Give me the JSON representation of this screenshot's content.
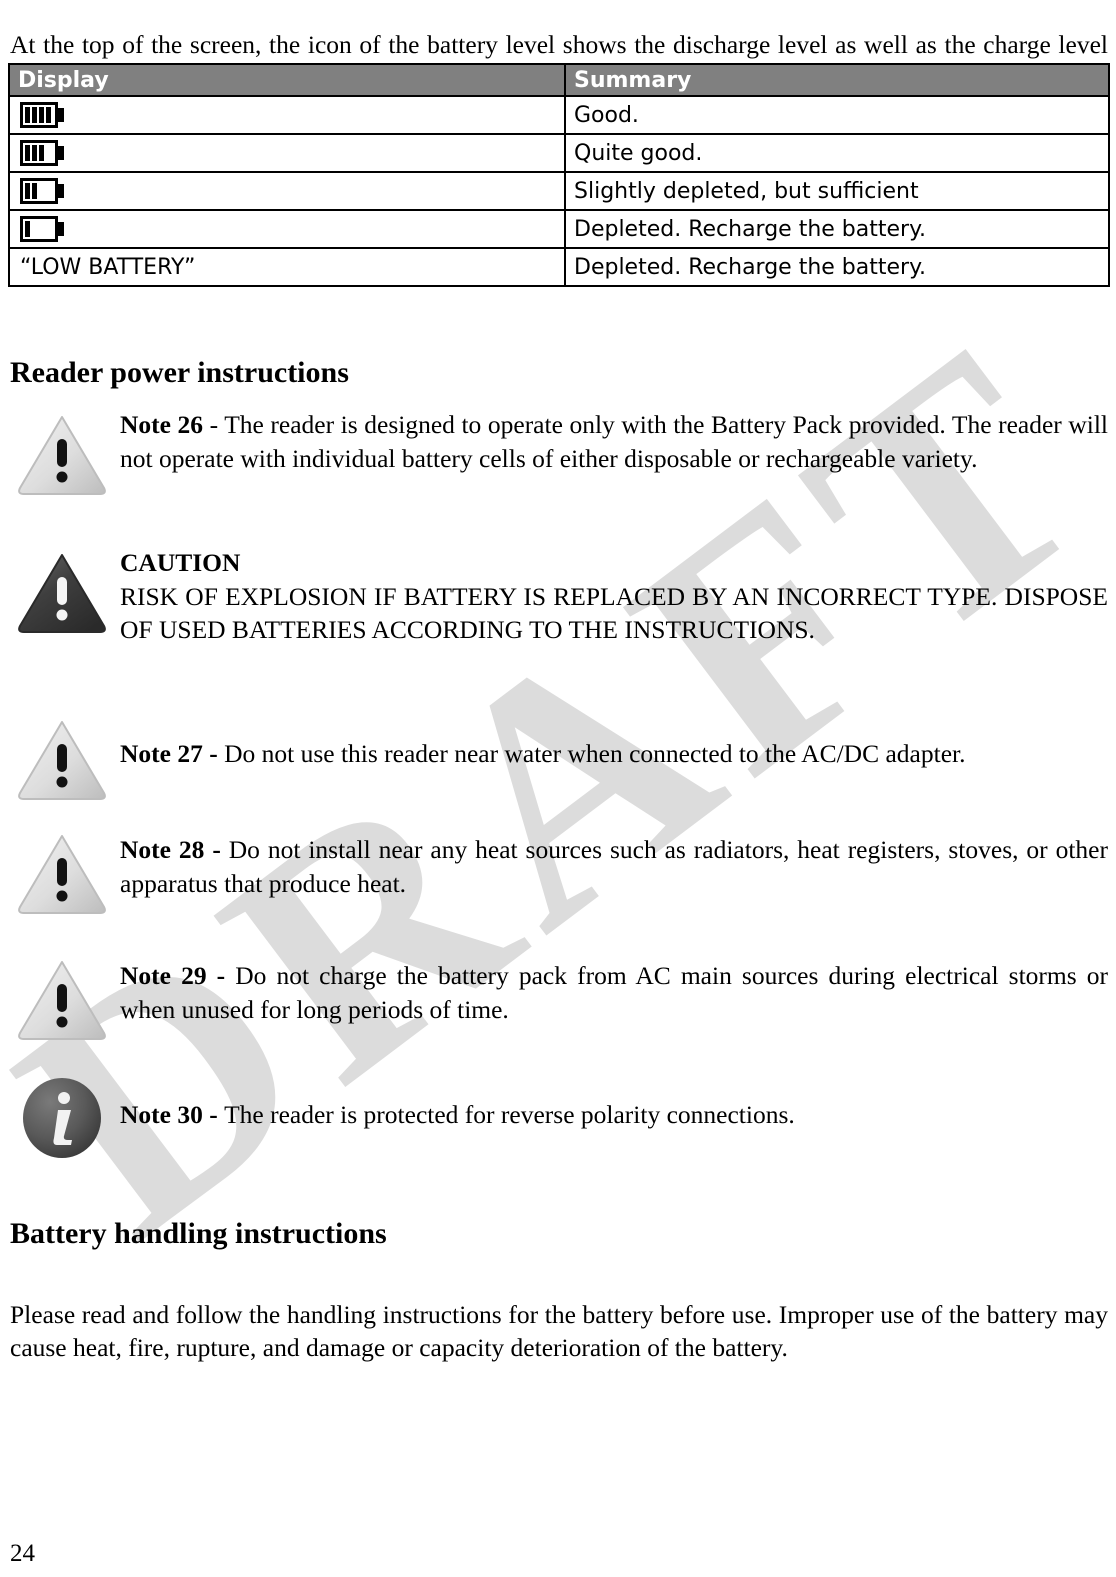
{
  "page": {
    "number": "24",
    "watermark": "DRAFT",
    "watermark_color": "#dcdcdc"
  },
  "intro": {
    "paragraph": "At the top of the screen, the icon of the battery level shows the discharge level as well as the charge level during the charge mode."
  },
  "battery_table": {
    "headers": {
      "display": "Display",
      "summary": "Summary"
    },
    "header_bg": "#808080",
    "header_fg": "#ffffff",
    "rows": [
      {
        "icon": "battery-full-icon",
        "bars": 4,
        "text": "",
        "summary": "Good."
      },
      {
        "icon": "battery-three-bars-icon",
        "bars": 3,
        "text": "",
        "summary": "Quite good."
      },
      {
        "icon": "battery-two-bars-icon",
        "bars": 2,
        "text": "",
        "summary": "Slightly depleted, but sufficient"
      },
      {
        "icon": "battery-one-bar-icon",
        "bars": 1,
        "text": "",
        "summary": "Depleted. Recharge the battery."
      },
      {
        "icon": "",
        "bars": 0,
        "text": "“LOW BATTERY”",
        "summary": "Depleted. Recharge the battery."
      }
    ]
  },
  "headings": {
    "reader_power": "Reader power instructions",
    "battery_handling": "Battery handling instructions"
  },
  "notes": [
    {
      "icon": "warning-triangle-light-icon",
      "lead": "Note 26",
      "separator": " - ",
      "body": "The reader is designed to operate only with the Battery Pack provided. The reader will not operate with individual battery cells of either disposable or rechargeable variety."
    },
    {
      "icon": "warning-triangle-dark-icon",
      "title": "CAUTION",
      "body": "RISK OF EXPLOSION IF BATTERY IS REPLACED BY AN INCORRECT TYPE. DISPOSE OF USED BATTERIES ACCORDING TO THE INSTRUCTIONS."
    },
    {
      "icon": "warning-triangle-light-icon",
      "lead": "Note 27 - ",
      "body": "Do not use this reader near water when connected to the AC/DC adapter."
    },
    {
      "icon": "warning-triangle-light-icon",
      "lead": "Note 28 - ",
      "body": "Do not install near any heat sources such as radiators, heat registers, stoves, or other apparatus that produce heat."
    },
    {
      "icon": "warning-triangle-light-icon",
      "lead": "Note 29 - ",
      "body": "Do not charge the battery pack from AC main sources during electrical storms or when unused for long periods of time."
    },
    {
      "icon": "info-circle-icon",
      "lead": "Note 30 - ",
      "body": "The reader is protected for reverse polarity connections."
    }
  ],
  "closing": {
    "paragraph": "Please read and follow the handling instructions for the battery before use. Improper use of the battery may cause heat, fire, rupture, and damage or capacity deterioration of the battery."
  }
}
